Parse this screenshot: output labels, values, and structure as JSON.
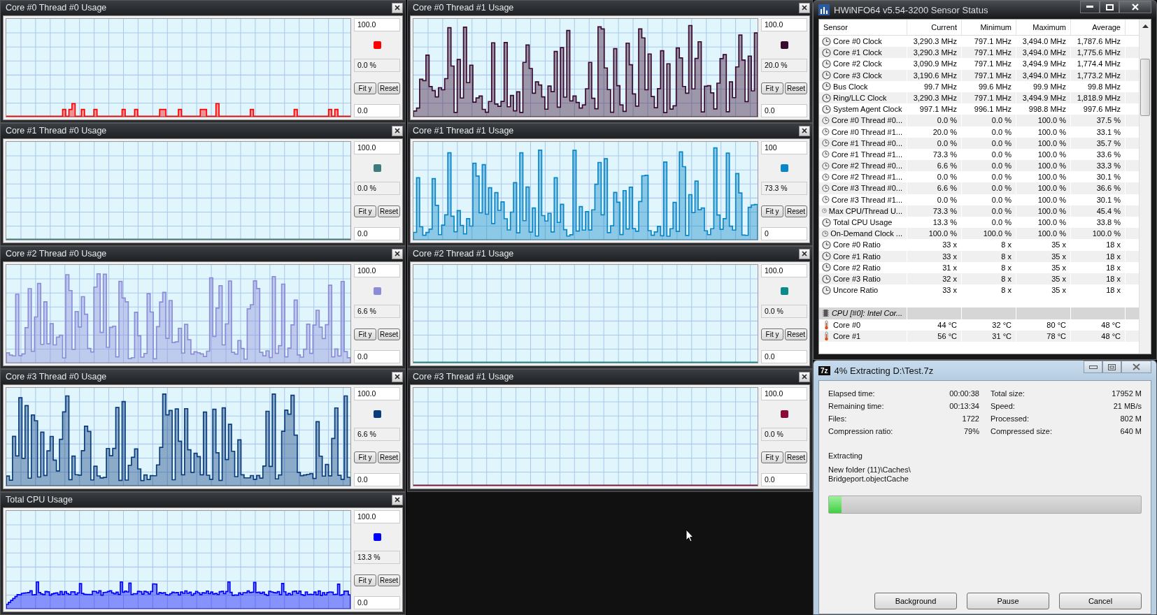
{
  "graphs": [
    {
      "title": "Core #0 Thread #0 Usage",
      "max": "100.0",
      "color": "#ff0000",
      "current": "0.0 %",
      "min": "0.0",
      "kind": "sparse",
      "fit_label": "Fit y",
      "reset_label": "Reset"
    },
    {
      "title": "Core #0 Thread #1 Usage",
      "max": "100.0",
      "color": "#3a0a2e",
      "current": "20.0 %",
      "min": "0.0",
      "kind": "spiky",
      "fit_label": "Fit y",
      "reset_label": "Reset"
    },
    {
      "title": "Core #1 Thread #0 Usage",
      "max": "100.0",
      "color": "#3f7a7c",
      "current": "0.0 %",
      "min": "0.0",
      "kind": "flat",
      "fit_label": "Fit y",
      "reset_label": "Reset"
    },
    {
      "title": "Core #1 Thread #1 Usage",
      "max": "100",
      "color": "#0a86c6",
      "current": "73.3 %",
      "min": "0",
      "kind": "spiky",
      "fit_label": "Fit y",
      "reset_label": "Reset"
    },
    {
      "title": "Core #2 Thread #0 Usage",
      "max": "100.0",
      "color": "#8c8cd6",
      "current": "6.6 %",
      "min": "0.0",
      "kind": "spiky",
      "fit_label": "Fit y",
      "reset_label": "Reset"
    },
    {
      "title": "Core #2 Thread #1 Usage",
      "max": "100.0",
      "color": "#0a8a8a",
      "current": "0.0 %",
      "min": "0.0",
      "kind": "flat",
      "fit_label": "Fit y",
      "reset_label": "Reset"
    },
    {
      "title": "Core #3 Thread #0 Usage",
      "max": "100.0",
      "color": "#0a3c7c",
      "current": "6.6 %",
      "min": "0.0",
      "kind": "spiky",
      "fit_label": "Fit y",
      "reset_label": "Reset"
    },
    {
      "title": "Core #3 Thread #1 Usage",
      "max": "100.0",
      "color": "#8a0a3c",
      "current": "0.0 %",
      "min": "0.0",
      "kind": "flat",
      "fit_label": "Fit y",
      "reset_label": "Reset"
    },
    {
      "title": "Total CPU Usage",
      "max": "100.0",
      "color": "#0000ff",
      "current": "13.3 %",
      "min": "0.0",
      "kind": "steady",
      "fit_label": "Fit y",
      "reset_label": "Reset"
    }
  ],
  "sensor_window": {
    "title": "HWiNFO64 v5.54-3200 Sensor Status",
    "columns": [
      "Sensor",
      "Current",
      "Minimum",
      "Maximum",
      "Average"
    ],
    "rows": [
      {
        "kind": "clock",
        "cells": [
          "Core #0 Clock",
          "3,290.3 MHz",
          "797.1 MHz",
          "3,494.0 MHz",
          "1,787.6 MHz"
        ]
      },
      {
        "kind": "clock",
        "cells": [
          "Core #1 Clock",
          "3,290.3 MHz",
          "797.1 MHz",
          "3,494.0 MHz",
          "1,775.6 MHz"
        ]
      },
      {
        "kind": "clock",
        "cells": [
          "Core #2 Clock",
          "3,090.9 MHz",
          "797.1 MHz",
          "3,494.9 MHz",
          "1,774.4 MHz"
        ]
      },
      {
        "kind": "clock",
        "cells": [
          "Core #3 Clock",
          "3,190.6 MHz",
          "797.1 MHz",
          "3,494.0 MHz",
          "1,773.2 MHz"
        ]
      },
      {
        "kind": "clock",
        "cells": [
          "Bus Clock",
          "99.7 MHz",
          "99.6 MHz",
          "99.9 MHz",
          "99.8 MHz"
        ]
      },
      {
        "kind": "clock",
        "cells": [
          "Ring/LLC Clock",
          "3,290.3 MHz",
          "797.1 MHz",
          "3,494.9 MHz",
          "1,818.9 MHz"
        ]
      },
      {
        "kind": "clock",
        "cells": [
          "System Agent Clock",
          "997.1 MHz",
          "996.1 MHz",
          "998.8 MHz",
          "997.6 MHz"
        ]
      },
      {
        "kind": "clock",
        "cells": [
          "Core #0 Thread #0...",
          "0.0 %",
          "0.0 %",
          "100.0 %",
          "37.5 %"
        ]
      },
      {
        "kind": "clock",
        "cells": [
          "Core #0 Thread #1...",
          "20.0 %",
          "0.0 %",
          "100.0 %",
          "33.1 %"
        ]
      },
      {
        "kind": "clock",
        "cells": [
          "Core #1 Thread #0...",
          "0.0 %",
          "0.0 %",
          "100.0 %",
          "35.7 %"
        ]
      },
      {
        "kind": "clock",
        "cells": [
          "Core #1 Thread #1...",
          "73.3 %",
          "0.0 %",
          "100.0 %",
          "33.6 %"
        ]
      },
      {
        "kind": "clock",
        "cells": [
          "Core #2 Thread #0...",
          "6.6 %",
          "0.0 %",
          "100.0 %",
          "33.3 %"
        ]
      },
      {
        "kind": "clock",
        "cells": [
          "Core #2 Thread #1...",
          "0.0 %",
          "0.0 %",
          "100.0 %",
          "30.1 %"
        ]
      },
      {
        "kind": "clock",
        "cells": [
          "Core #3 Thread #0...",
          "6.6 %",
          "0.0 %",
          "100.0 %",
          "36.6 %"
        ]
      },
      {
        "kind": "clock",
        "cells": [
          "Core #3 Thread #1...",
          "0.0 %",
          "0.0 %",
          "100.0 %",
          "30.1 %"
        ]
      },
      {
        "kind": "clock",
        "cells": [
          "Max CPU/Thread U...",
          "73.3 %",
          "0.0 %",
          "100.0 %",
          "45.4 %"
        ]
      },
      {
        "kind": "clock",
        "cells": [
          "Total CPU Usage",
          "13.3 %",
          "0.0 %",
          "100.0 %",
          "33.8 %"
        ]
      },
      {
        "kind": "clock",
        "cells": [
          "On-Demand Clock ...",
          "100.0 %",
          "100.0 %",
          "100.0 %",
          "100.0 %"
        ]
      },
      {
        "kind": "clock",
        "cells": [
          "Core #0 Ratio",
          "33 x",
          "8 x",
          "35 x",
          "18 x"
        ]
      },
      {
        "kind": "clock",
        "cells": [
          "Core #1 Ratio",
          "33 x",
          "8 x",
          "35 x",
          "18 x"
        ]
      },
      {
        "kind": "clock",
        "cells": [
          "Core #2 Ratio",
          "31 x",
          "8 x",
          "35 x",
          "18 x"
        ]
      },
      {
        "kind": "clock",
        "cells": [
          "Core #3 Ratio",
          "32 x",
          "8 x",
          "35 x",
          "18 x"
        ]
      },
      {
        "kind": "clock",
        "cells": [
          "Uncore Ratio",
          "33 x",
          "8 x",
          "35 x",
          "18 x"
        ]
      },
      {
        "kind": "group",
        "cells": [
          "CPU [#0]: Intel Cor..."
        ]
      },
      {
        "kind": "temperature",
        "cells": [
          "Core #0",
          "44 °C",
          "32 °C",
          "80 °C",
          "48 °C"
        ]
      },
      {
        "kind": "temperature",
        "cells": [
          "Core #1",
          "56 °C",
          "31 °C",
          "78 °C",
          "48 °C"
        ]
      }
    ]
  },
  "extract_window": {
    "icon_text": "7z",
    "title": "4% Extracting D:\\Test.7z",
    "stats_left": [
      {
        "label": "Elapsed time:",
        "value": "00:00:38"
      },
      {
        "label": "Remaining time:",
        "value": "00:13:34"
      },
      {
        "label": "Files:",
        "value": "1722"
      },
      {
        "label": "Compression ratio:",
        "value": "79%"
      }
    ],
    "stats_right": [
      {
        "label": "Total size:",
        "value": "17952 M"
      },
      {
        "label": "Speed:",
        "value": "21 MB/s"
      },
      {
        "label": "Processed:",
        "value": "802 M"
      },
      {
        "label": "Compressed size:",
        "value": "640 M"
      }
    ],
    "action": "Extracting",
    "path_lines": [
      "New folder (11)\\Caches\\",
      "Bridgeport.objectCache"
    ],
    "progress": {
      "level": 0.04
    },
    "buttons": [
      "Background",
      "Pause",
      "Cancel"
    ]
  }
}
